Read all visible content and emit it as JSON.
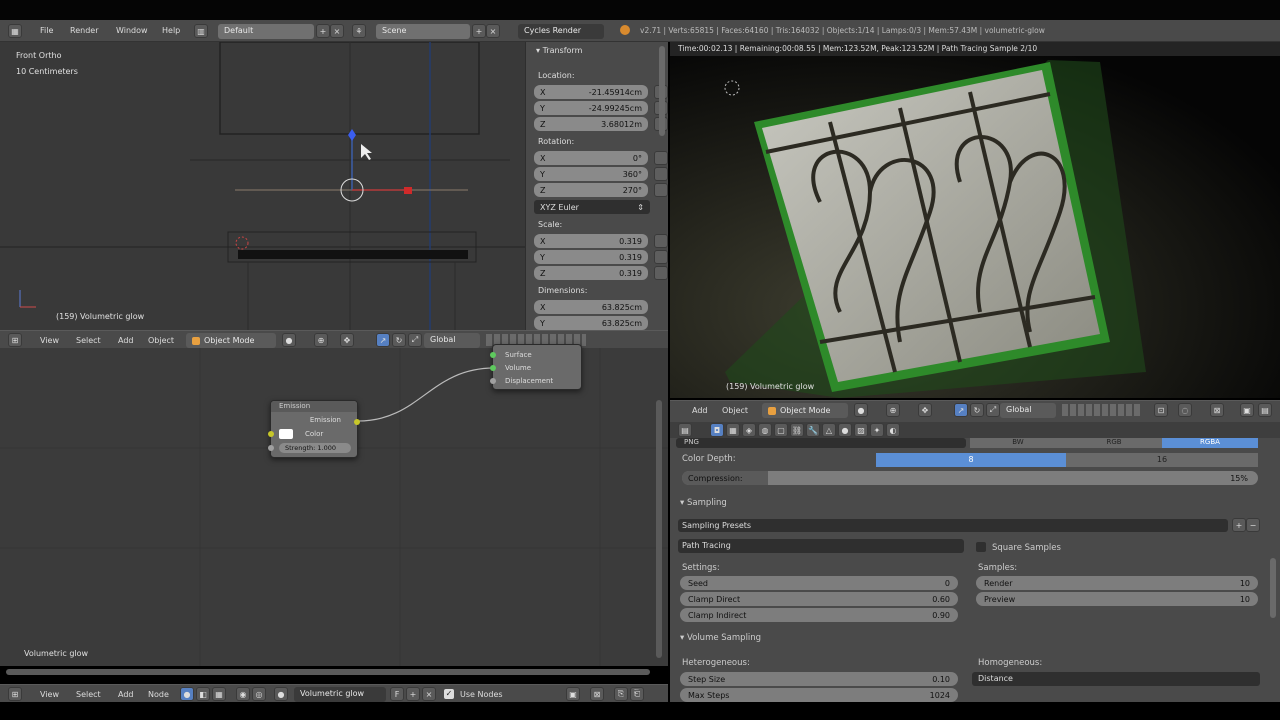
{
  "infobar": {
    "menu": [
      "File",
      "Render",
      "Window",
      "Help"
    ],
    "layout": "Default",
    "scene": "Scene",
    "engine": "Cycles Render",
    "stats": "v2.71 | Verts:65815 | Faces:64160 | Tris:164032 | Objects:1/14 | Lamps:0/3 | Mem:57.43M | volumetric-glow"
  },
  "viewport": {
    "view_name": "Front Ortho",
    "scale": "10 Centimeters",
    "object_label": "(159) Volumetric glow"
  },
  "npanel": {
    "transform_header": "Transform",
    "location_label": "Location:",
    "location": [
      {
        "axis": "X",
        "value": "-21.45914cm"
      },
      {
        "axis": "Y",
        "value": "-24.99245cm"
      },
      {
        "axis": "Z",
        "value": "3.68012m"
      }
    ],
    "rotation_label": "Rotation:",
    "rotation": [
      {
        "axis": "X",
        "value": "0°"
      },
      {
        "axis": "Y",
        "value": "360°"
      },
      {
        "axis": "Z",
        "value": "270°"
      }
    ],
    "rotation_mode": "XYZ Euler",
    "scale_label": "Scale:",
    "scale": [
      {
        "axis": "X",
        "value": "0.319"
      },
      {
        "axis": "Y",
        "value": "0.319"
      },
      {
        "axis": "Z",
        "value": "0.319"
      }
    ],
    "dimensions_label": "Dimensions:",
    "dimensions": [
      {
        "axis": "X",
        "value": "63.825cm"
      },
      {
        "axis": "Y",
        "value": "63.825cm"
      }
    ]
  },
  "viewport_header": {
    "menu": [
      "View",
      "Select",
      "Add",
      "Object"
    ],
    "mode": "Object Mode",
    "orientation": "Global"
  },
  "nodes": {
    "emission": {
      "title": "Emission",
      "output": "Emission",
      "color_label": "Color",
      "strength": "Strength: 1.000"
    },
    "output": {
      "inputs": [
        "Surface",
        "Volume",
        "Displacement"
      ]
    },
    "material_label": "Volumetric glow"
  },
  "node_header": {
    "menu": [
      "View",
      "Select",
      "Add",
      "Node"
    ],
    "material": "Volumetric glow",
    "fake_user": "F",
    "use_nodes": "Use Nodes"
  },
  "render": {
    "status": "Time:00:02.13 | Remaining:00:08.55 | Mem:123.52M, Peak:123.52M | Path Tracing Sample 2/10",
    "object_label": "(159) Volumetric glow"
  },
  "render_header": {
    "menu": [
      "Add",
      "Object"
    ],
    "mode": "Object Mode",
    "orientation": "Global"
  },
  "props": {
    "format_tabs": [
      "PNG",
      "BW",
      "RGB",
      "RGBA"
    ],
    "color_depth_label": "Color Depth:",
    "color_depth_options": [
      "8",
      "16"
    ],
    "compression_label": "Compression:",
    "compression_value": "15%",
    "compression_fraction": 0.15,
    "sampling_header": "Sampling",
    "sampling_presets": "Sampling Presets",
    "integrator": "Path Tracing",
    "square_samples": "Square Samples",
    "settings_label": "Settings:",
    "settings": [
      {
        "name": "Seed",
        "value": "0"
      },
      {
        "name": "Clamp Direct",
        "value": "0.60"
      },
      {
        "name": "Clamp Indirect",
        "value": "0.90"
      }
    ],
    "samples_label": "Samples:",
    "samples": [
      {
        "name": "Render",
        "value": "10"
      },
      {
        "name": "Preview",
        "value": "10"
      }
    ],
    "volume_header": "Volume Sampling",
    "heterogeneous_label": "Heterogeneous:",
    "volume_settings": [
      {
        "name": "Step Size",
        "value": "0.10"
      },
      {
        "name": "Max Steps",
        "value": "1024"
      }
    ],
    "homogeneous_label": "Homogeneous:",
    "homogeneous_value": "Distance"
  },
  "colors": {
    "accent": "#5680c2",
    "selection": "#5b8fd6",
    "socket": "#c7c729"
  }
}
